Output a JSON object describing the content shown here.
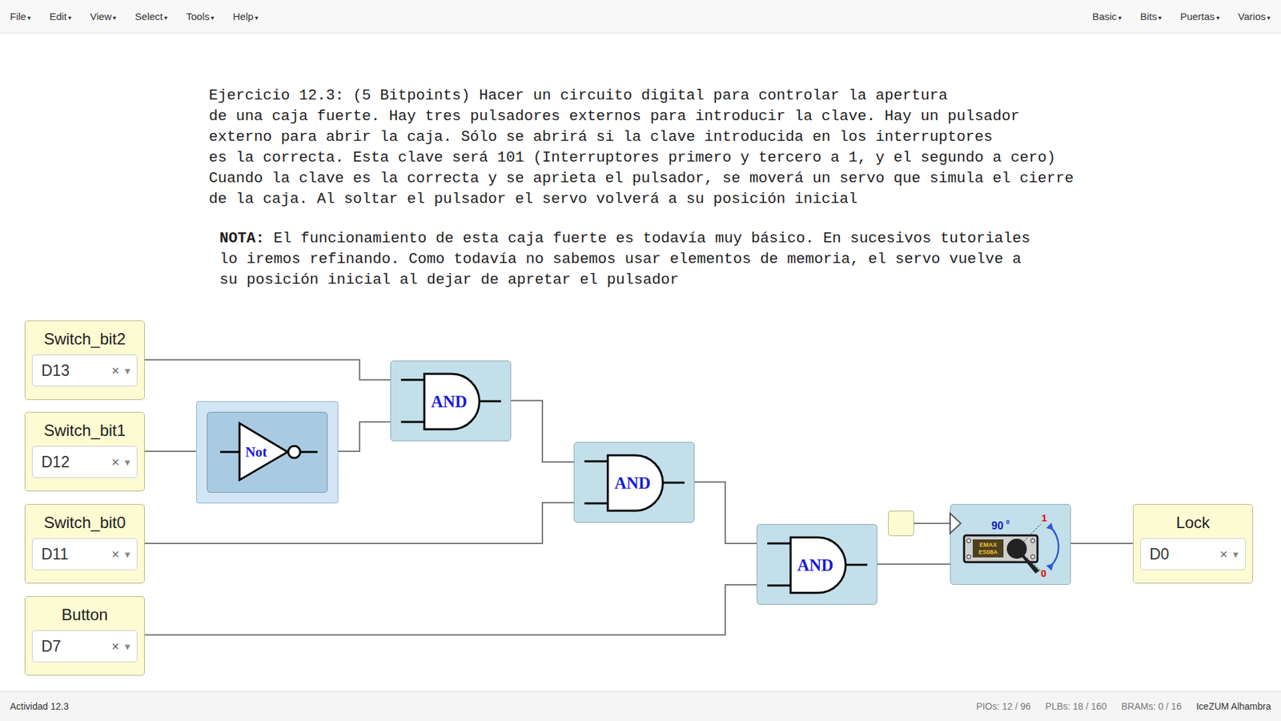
{
  "menu": {
    "left": [
      "File",
      "Edit",
      "View",
      "Select",
      "Tools",
      "Help"
    ],
    "right": [
      "Basic",
      "Bits",
      "Puertas",
      "Varios"
    ],
    "caret": "▾"
  },
  "exercise": {
    "lines": [
      "Ejercicio 12.3: (5 Bitpoints) Hacer un circuito digital para controlar la apertura",
      "de una caja fuerte. Hay tres pulsadores externos para introducir la clave. Hay un pulsador",
      "externo para abrir la caja. Sólo se abrirá si la clave introducida en los interruptores",
      "es la correcta. Esta clave será 101 (Interruptores primero y tercero a 1, y el segundo a cero)",
      "Cuando la clave es la correcta y se aprieta el pulsador, se moverá un servo que simula el cierre",
      "de la caja. Al soltar el pulsador el servo volverá a su posición inicial"
    ]
  },
  "note": {
    "label": "NOTA:",
    "first": " El funcionamiento de esta caja fuerte es todavía muy básico. En sucesivos tutoriales",
    "lines": [
      "lo iremos refinando. Como todavía no sabemos usar elementos de memoria, el servo vuelve a",
      "su posición inicial al dejar de apretar el pulsador"
    ]
  },
  "inputs": [
    {
      "name": "Switch_bit2",
      "pin": "D13"
    },
    {
      "name": "Switch_bit1",
      "pin": "D12"
    },
    {
      "name": "Switch_bit0",
      "pin": "D11"
    },
    {
      "name": "Button",
      "pin": "D7"
    }
  ],
  "outputs": [
    {
      "name": "Lock",
      "pin": "D0"
    }
  ],
  "select": {
    "clear": "×",
    "caret": "▾"
  },
  "gates": [
    {
      "kind": "not",
      "label": "Not",
      "selected": true
    },
    {
      "kind": "and",
      "label": "AND",
      "selected": false
    },
    {
      "kind": "and",
      "label": "AND",
      "selected": false
    },
    {
      "kind": "and",
      "label": "AND",
      "selected": false
    }
  ],
  "servo": {
    "angle": "90",
    "degree": "0",
    "high": "1",
    "low": "0",
    "brand": "EMAX",
    "model": "ES08A"
  },
  "status_bar": {
    "activity": "Actividad 12.3",
    "stats": [
      "PIOs: 12 / 96",
      "PLBs: 18 / 160",
      "BRAMs: 0 / 16"
    ],
    "board": "IceZUM Alhambra"
  }
}
